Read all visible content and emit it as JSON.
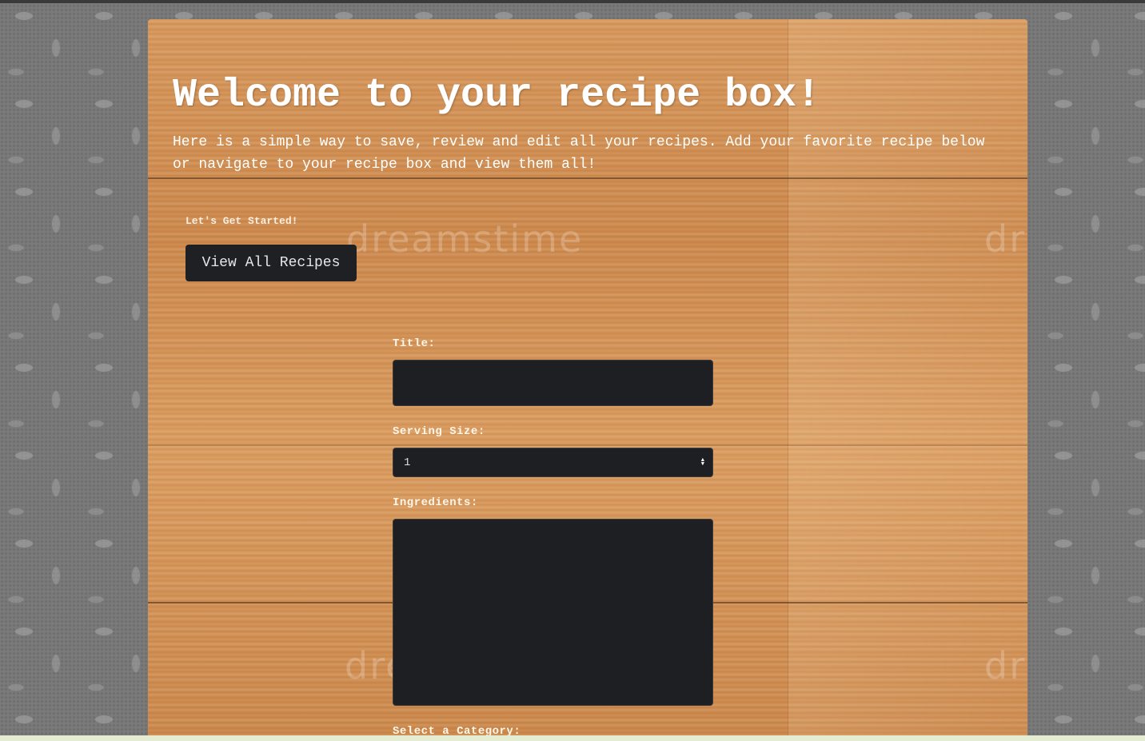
{
  "hero": {
    "title": "Welcome to your recipe box!",
    "subtitle": "Here is a simple way to save, review and edit all your recipes. Add your favorite recipe below or navigate to your recipe box and view them all!"
  },
  "intro": {
    "label": "Let's Get Started!",
    "view_all_label": "View All Recipes"
  },
  "watermark": "dreamstime",
  "form": {
    "title_label": "Title:",
    "title_value": "",
    "serving_label": "Serving Size:",
    "serving_value": "1",
    "ingredients_label": "Ingredients:",
    "ingredients_value": "",
    "category_label": "Select a Category:"
  },
  "colors": {
    "field_bg": "#1d1f22",
    "button_bg": "#1e2023",
    "text_light": "#ffffff"
  }
}
